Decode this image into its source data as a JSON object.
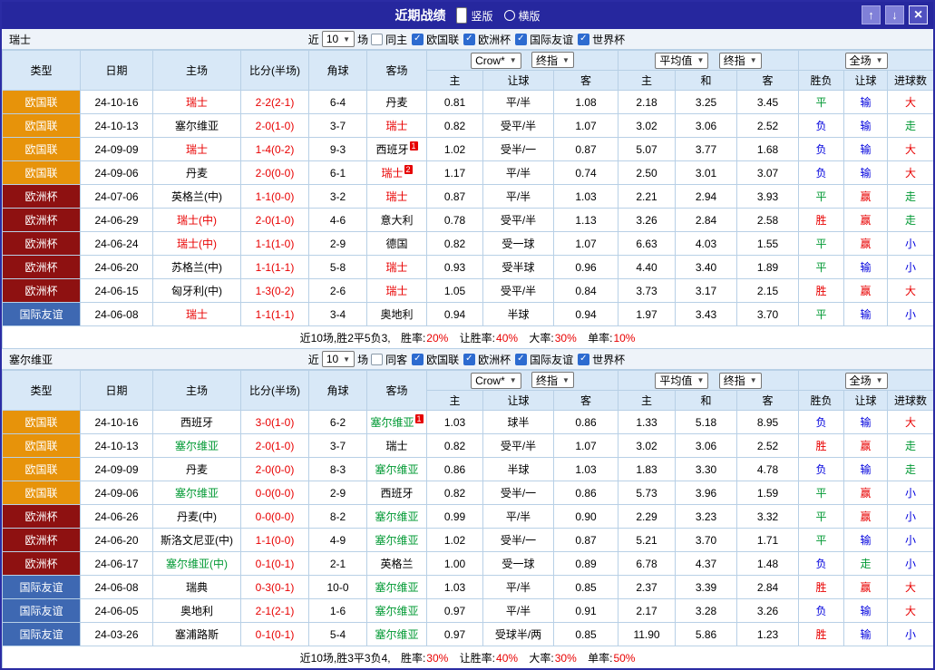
{
  "titlebar": {
    "title": "近期战绩",
    "orientation_options": [
      {
        "label": "竖版",
        "selected": true
      },
      {
        "label": "横版",
        "selected": false
      }
    ],
    "window_buttons": {
      "up": "↑",
      "down": "↓",
      "close": "×"
    }
  },
  "filter_labels": {
    "recent": "近",
    "matches": "场"
  },
  "league_filters": [
    "欧国联",
    "欧洲杯",
    "国际友谊",
    "世界杯"
  ],
  "selects": {
    "crown": "Crow*",
    "final": "终指",
    "average": "平均值",
    "final2": "终指",
    "fulltime": "全场"
  },
  "columns": {
    "type": "类型",
    "date": "日期",
    "home": "主场",
    "score": "比分(半场)",
    "corners": "角球",
    "away": "客场",
    "crown_home": "主",
    "crown_handicap": "让球",
    "crown_away": "客",
    "avg_home": "主",
    "avg_draw": "和",
    "avg_away": "客",
    "result": "胜负",
    "handicap": "让球",
    "goals": "进球数"
  },
  "sections": [
    {
      "team": "瑞士",
      "filter": {
        "count": "10",
        "same_label": "同主",
        "same_checked": false
      },
      "rows": [
        {
          "league": "欧国联",
          "league_color": "orange",
          "date": "24-10-16",
          "home": {
            "name": "瑞士",
            "color": "red",
            "sup": ""
          },
          "score": "2-2(2-1)",
          "corners": "6-4",
          "away": {
            "name": "丹麦",
            "color": "black",
            "sup": ""
          },
          "crown": [
            "0.81",
            "平/半",
            "1.08"
          ],
          "average": [
            "2.18",
            "3.25",
            "3.45"
          ],
          "result": {
            "text": "平",
            "color": "green"
          },
          "handicap": {
            "text": "输",
            "color": "blue"
          },
          "goals": {
            "text": "大",
            "color": "red"
          }
        },
        {
          "league": "欧国联",
          "league_color": "orange",
          "date": "24-10-13",
          "home": {
            "name": "塞尔维亚",
            "color": "black",
            "sup": ""
          },
          "score": "2-0(1-0)",
          "corners": "3-7",
          "away": {
            "name": "瑞士",
            "color": "red",
            "sup": ""
          },
          "crown": [
            "0.82",
            "受平/半",
            "1.07"
          ],
          "average": [
            "3.02",
            "3.06",
            "2.52"
          ],
          "result": {
            "text": "负",
            "color": "blue"
          },
          "handicap": {
            "text": "输",
            "color": "blue"
          },
          "goals": {
            "text": "走",
            "color": "green"
          }
        },
        {
          "league": "欧国联",
          "league_color": "orange",
          "date": "24-09-09",
          "home": {
            "name": "瑞士",
            "color": "red",
            "sup": ""
          },
          "score": "1-4(0-2)",
          "corners": "9-3",
          "away": {
            "name": "西班牙",
            "color": "black",
            "sup": "1"
          },
          "crown": [
            "1.02",
            "受半/一",
            "0.87"
          ],
          "average": [
            "5.07",
            "3.77",
            "1.68"
          ],
          "result": {
            "text": "负",
            "color": "blue"
          },
          "handicap": {
            "text": "输",
            "color": "blue"
          },
          "goals": {
            "text": "大",
            "color": "red"
          }
        },
        {
          "league": "欧国联",
          "league_color": "orange",
          "date": "24-09-06",
          "home": {
            "name": "丹麦",
            "color": "black",
            "sup": ""
          },
          "score": "2-0(0-0)",
          "corners": "6-1",
          "away": {
            "name": "瑞士",
            "color": "red",
            "sup": "2"
          },
          "crown": [
            "1.17",
            "平/半",
            "0.74"
          ],
          "average": [
            "2.50",
            "3.01",
            "3.07"
          ],
          "result": {
            "text": "负",
            "color": "blue"
          },
          "handicap": {
            "text": "输",
            "color": "blue"
          },
          "goals": {
            "text": "大",
            "color": "red"
          }
        },
        {
          "league": "欧洲杯",
          "league_color": "maroon",
          "date": "24-07-06",
          "home": {
            "name": "英格兰(中)",
            "color": "black",
            "sup": ""
          },
          "score": "1-1(0-0)",
          "corners": "3-2",
          "away": {
            "name": "瑞士",
            "color": "red",
            "sup": ""
          },
          "crown": [
            "0.87",
            "平/半",
            "1.03"
          ],
          "average": [
            "2.21",
            "2.94",
            "3.93"
          ],
          "result": {
            "text": "平",
            "color": "green"
          },
          "handicap": {
            "text": "赢",
            "color": "red"
          },
          "goals": {
            "text": "走",
            "color": "green"
          }
        },
        {
          "league": "欧洲杯",
          "league_color": "maroon",
          "date": "24-06-29",
          "home": {
            "name": "瑞士(中)",
            "color": "red",
            "sup": ""
          },
          "score": "2-0(1-0)",
          "corners": "4-6",
          "away": {
            "name": "意大利",
            "color": "black",
            "sup": ""
          },
          "crown": [
            "0.78",
            "受平/半",
            "1.13"
          ],
          "average": [
            "3.26",
            "2.84",
            "2.58"
          ],
          "result": {
            "text": "胜",
            "color": "red"
          },
          "handicap": {
            "text": "赢",
            "color": "red"
          },
          "goals": {
            "text": "走",
            "color": "green"
          }
        },
        {
          "league": "欧洲杯",
          "league_color": "maroon",
          "date": "24-06-24",
          "home": {
            "name": "瑞士(中)",
            "color": "red",
            "sup": ""
          },
          "score": "1-1(1-0)",
          "corners": "2-9",
          "away": {
            "name": "德国",
            "color": "black",
            "sup": ""
          },
          "crown": [
            "0.82",
            "受一球",
            "1.07"
          ],
          "average": [
            "6.63",
            "4.03",
            "1.55"
          ],
          "result": {
            "text": "平",
            "color": "green"
          },
          "handicap": {
            "text": "赢",
            "color": "red"
          },
          "goals": {
            "text": "小",
            "color": "blue"
          }
        },
        {
          "league": "欧洲杯",
          "league_color": "maroon",
          "date": "24-06-20",
          "home": {
            "name": "苏格兰(中)",
            "color": "black",
            "sup": ""
          },
          "score": "1-1(1-1)",
          "corners": "5-8",
          "away": {
            "name": "瑞士",
            "color": "red",
            "sup": ""
          },
          "crown": [
            "0.93",
            "受半球",
            "0.96"
          ],
          "average": [
            "4.40",
            "3.40",
            "1.89"
          ],
          "result": {
            "text": "平",
            "color": "green"
          },
          "handicap": {
            "text": "输",
            "color": "blue"
          },
          "goals": {
            "text": "小",
            "color": "blue"
          }
        },
        {
          "league": "欧洲杯",
          "league_color": "maroon",
          "date": "24-06-15",
          "home": {
            "name": "匈牙利(中)",
            "color": "black",
            "sup": ""
          },
          "score": "1-3(0-2)",
          "corners": "2-6",
          "away": {
            "name": "瑞士",
            "color": "red",
            "sup": ""
          },
          "crown": [
            "1.05",
            "受平/半",
            "0.84"
          ],
          "average": [
            "3.73",
            "3.17",
            "2.15"
          ],
          "result": {
            "text": "胜",
            "color": "red"
          },
          "handicap": {
            "text": "赢",
            "color": "red"
          },
          "goals": {
            "text": "大",
            "color": "red"
          }
        },
        {
          "league": "国际友谊",
          "league_color": "blue",
          "date": "24-06-08",
          "home": {
            "name": "瑞士",
            "color": "red",
            "sup": ""
          },
          "score": "1-1(1-1)",
          "corners": "3-4",
          "away": {
            "name": "奥地利",
            "color": "black",
            "sup": ""
          },
          "crown": [
            "0.94",
            "半球",
            "0.94"
          ],
          "average": [
            "1.97",
            "3.43",
            "3.70"
          ],
          "result": {
            "text": "平",
            "color": "green"
          },
          "handicap": {
            "text": "输",
            "color": "blue"
          },
          "goals": {
            "text": "小",
            "color": "blue"
          }
        }
      ],
      "summary": {
        "prefix": "近10场,胜2平5负3,",
        "stats": [
          {
            "label": "胜率:",
            "value": "20%"
          },
          {
            "label": "让胜率:",
            "value": "40%"
          },
          {
            "label": "大率:",
            "value": "30%"
          },
          {
            "label": "单率:",
            "value": "10%"
          }
        ]
      }
    },
    {
      "team": "塞尔维亚",
      "filter": {
        "count": "10",
        "same_label": "同客",
        "same_checked": false
      },
      "rows": [
        {
          "league": "欧国联",
          "league_color": "orange",
          "date": "24-10-16",
          "home": {
            "name": "西班牙",
            "color": "black",
            "sup": ""
          },
          "score": "3-0(1-0)",
          "corners": "6-2",
          "away": {
            "name": "塞尔维亚",
            "color": "green",
            "sup": "1"
          },
          "crown": [
            "1.03",
            "球半",
            "0.86"
          ],
          "average": [
            "1.33",
            "5.18",
            "8.95"
          ],
          "result": {
            "text": "负",
            "color": "blue"
          },
          "handicap": {
            "text": "输",
            "color": "blue"
          },
          "goals": {
            "text": "大",
            "color": "red"
          }
        },
        {
          "league": "欧国联",
          "league_color": "orange",
          "date": "24-10-13",
          "home": {
            "name": "塞尔维亚",
            "color": "green",
            "sup": ""
          },
          "score": "2-0(1-0)",
          "corners": "3-7",
          "away": {
            "name": "瑞士",
            "color": "black",
            "sup": ""
          },
          "crown": [
            "0.82",
            "受平/半",
            "1.07"
          ],
          "average": [
            "3.02",
            "3.06",
            "2.52"
          ],
          "result": {
            "text": "胜",
            "color": "red"
          },
          "handicap": {
            "text": "赢",
            "color": "red"
          },
          "goals": {
            "text": "走",
            "color": "green"
          }
        },
        {
          "league": "欧国联",
          "league_color": "orange",
          "date": "24-09-09",
          "home": {
            "name": "丹麦",
            "color": "black",
            "sup": ""
          },
          "score": "2-0(0-0)",
          "corners": "8-3",
          "away": {
            "name": "塞尔维亚",
            "color": "green",
            "sup": ""
          },
          "crown": [
            "0.86",
            "半球",
            "1.03"
          ],
          "average": [
            "1.83",
            "3.30",
            "4.78"
          ],
          "result": {
            "text": "负",
            "color": "blue"
          },
          "handicap": {
            "text": "输",
            "color": "blue"
          },
          "goals": {
            "text": "走",
            "color": "green"
          }
        },
        {
          "league": "欧国联",
          "league_color": "orange",
          "date": "24-09-06",
          "home": {
            "name": "塞尔维亚",
            "color": "green",
            "sup": ""
          },
          "score": "0-0(0-0)",
          "corners": "2-9",
          "away": {
            "name": "西班牙",
            "color": "black",
            "sup": ""
          },
          "crown": [
            "0.82",
            "受半/一",
            "0.86"
          ],
          "average": [
            "5.73",
            "3.96",
            "1.59"
          ],
          "result": {
            "text": "平",
            "color": "green"
          },
          "handicap": {
            "text": "赢",
            "color": "red"
          },
          "goals": {
            "text": "小",
            "color": "blue"
          }
        },
        {
          "league": "欧洲杯",
          "league_color": "maroon",
          "date": "24-06-26",
          "home": {
            "name": "丹麦(中)",
            "color": "black",
            "sup": ""
          },
          "score": "0-0(0-0)",
          "corners": "8-2",
          "away": {
            "name": "塞尔维亚",
            "color": "green",
            "sup": ""
          },
          "crown": [
            "0.99",
            "平/半",
            "0.90"
          ],
          "average": [
            "2.29",
            "3.23",
            "3.32"
          ],
          "result": {
            "text": "平",
            "color": "green"
          },
          "handicap": {
            "text": "赢",
            "color": "red"
          },
          "goals": {
            "text": "小",
            "color": "blue"
          }
        },
        {
          "league": "欧洲杯",
          "league_color": "maroon",
          "date": "24-06-20",
          "home": {
            "name": "斯洛文尼亚(中)",
            "color": "black",
            "sup": ""
          },
          "score": "1-1(0-0)",
          "corners": "4-9",
          "away": {
            "name": "塞尔维亚",
            "color": "green",
            "sup": ""
          },
          "crown": [
            "1.02",
            "受半/一",
            "0.87"
          ],
          "average": [
            "5.21",
            "3.70",
            "1.71"
          ],
          "result": {
            "text": "平",
            "color": "green"
          },
          "handicap": {
            "text": "输",
            "color": "blue"
          },
          "goals": {
            "text": "小",
            "color": "blue"
          }
        },
        {
          "league": "欧洲杯",
          "league_color": "maroon",
          "date": "24-06-17",
          "home": {
            "name": "塞尔维亚(中)",
            "color": "green",
            "sup": ""
          },
          "score": "0-1(0-1)",
          "corners": "2-1",
          "away": {
            "name": "英格兰",
            "color": "black",
            "sup": ""
          },
          "crown": [
            "1.00",
            "受一球",
            "0.89"
          ],
          "average": [
            "6.78",
            "4.37",
            "1.48"
          ],
          "result": {
            "text": "负",
            "color": "blue"
          },
          "handicap": {
            "text": "走",
            "color": "green"
          },
          "goals": {
            "text": "小",
            "color": "blue"
          }
        },
        {
          "league": "国际友谊",
          "league_color": "blue",
          "date": "24-06-08",
          "home": {
            "name": "瑞典",
            "color": "black",
            "sup": ""
          },
          "score": "0-3(0-1)",
          "corners": "10-0",
          "away": {
            "name": "塞尔维亚",
            "color": "green",
            "sup": ""
          },
          "crown": [
            "1.03",
            "平/半",
            "0.85"
          ],
          "average": [
            "2.37",
            "3.39",
            "2.84"
          ],
          "result": {
            "text": "胜",
            "color": "red"
          },
          "handicap": {
            "text": "赢",
            "color": "red"
          },
          "goals": {
            "text": "大",
            "color": "red"
          }
        },
        {
          "league": "国际友谊",
          "league_color": "blue",
          "date": "24-06-05",
          "home": {
            "name": "奥地利",
            "color": "black",
            "sup": ""
          },
          "score": "2-1(2-1)",
          "corners": "1-6",
          "away": {
            "name": "塞尔维亚",
            "color": "green",
            "sup": ""
          },
          "crown": [
            "0.97",
            "平/半",
            "0.91"
          ],
          "average": [
            "2.17",
            "3.28",
            "3.26"
          ],
          "result": {
            "text": "负",
            "color": "blue"
          },
          "handicap": {
            "text": "输",
            "color": "blue"
          },
          "goals": {
            "text": "大",
            "color": "red"
          }
        },
        {
          "league": "国际友谊",
          "league_color": "blue",
          "date": "24-03-26",
          "home": {
            "name": "塞浦路斯",
            "color": "black",
            "sup": ""
          },
          "score": "0-1(0-1)",
          "corners": "5-4",
          "away": {
            "name": "塞尔维亚",
            "color": "green",
            "sup": ""
          },
          "crown": [
            "0.97",
            "受球半/两",
            "0.85"
          ],
          "average": [
            "11.90",
            "5.86",
            "1.23"
          ],
          "result": {
            "text": "胜",
            "color": "red"
          },
          "handicap": {
            "text": "输",
            "color": "blue"
          },
          "goals": {
            "text": "小",
            "color": "blue"
          }
        }
      ],
      "summary": {
        "prefix": "近10场,胜3平3负4,",
        "stats": [
          {
            "label": "胜率:",
            "value": "30%"
          },
          {
            "label": "让胜率:",
            "value": "40%"
          },
          {
            "label": "大率:",
            "value": "30%"
          },
          {
            "label": "单率:",
            "value": "50%"
          }
        ]
      }
    }
  ]
}
